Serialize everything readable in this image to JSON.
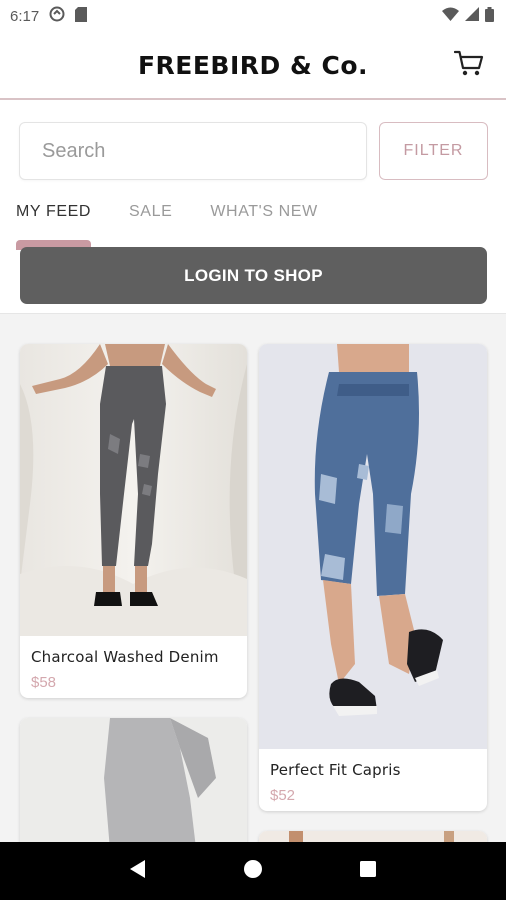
{
  "status_bar": {
    "time": "6:17"
  },
  "header": {
    "brand": "FREEBIRD & Co."
  },
  "search": {
    "placeholder": "Search",
    "filter_label": "FILTER"
  },
  "tabs": [
    {
      "label": "MY FEED",
      "active": true
    },
    {
      "label": "SALE",
      "active": false
    },
    {
      "label": "WHAT'S NEW",
      "active": false
    }
  ],
  "login": {
    "label": "LOGIN TO SHOP"
  },
  "products": [
    {
      "name": "Charcoal Washed Denim",
      "price": "$58"
    },
    {
      "name": "Perfect Fit Capris",
      "price": "$52"
    }
  ],
  "colors": {
    "accent": "#c99aa2",
    "price": "#d4a8ae",
    "login_bg": "#5f5f5f"
  }
}
